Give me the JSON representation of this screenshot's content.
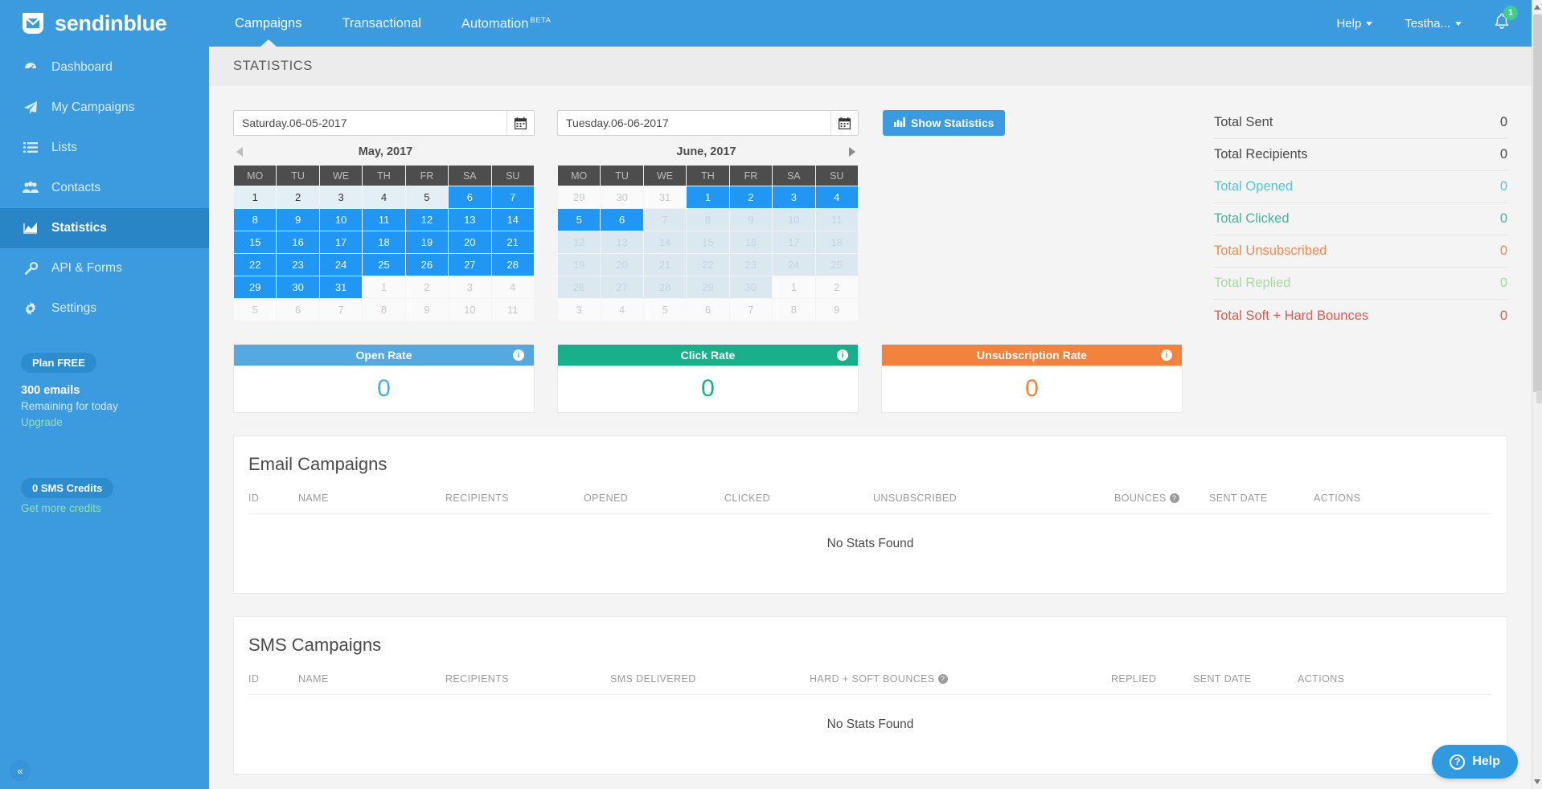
{
  "brand": {
    "name": "sendinblue",
    "logo_icon": "envelope-logo-icon"
  },
  "topnav": {
    "items": [
      {
        "label": "Campaigns",
        "active": true
      },
      {
        "label": "Transactional",
        "active": false
      },
      {
        "label": "Automation",
        "badge": "BETA",
        "active": false
      }
    ],
    "right": {
      "help_label": "Help",
      "account_label": "Testha...",
      "bell_icon": "bell-icon",
      "notification_count": "1"
    }
  },
  "sidebar": {
    "items": [
      {
        "label": "Dashboard",
        "icon": "dashboard-icon",
        "active": false
      },
      {
        "label": "My Campaigns",
        "icon": "paper-plane-icon",
        "active": false
      },
      {
        "label": "Lists",
        "icon": "list-icon",
        "active": false
      },
      {
        "label": "Contacts",
        "icon": "contacts-icon",
        "active": false
      },
      {
        "label": "Statistics",
        "icon": "chart-icon",
        "active": true
      },
      {
        "label": "API & Forms",
        "icon": "wrench-icon",
        "active": false
      },
      {
        "label": "Settings",
        "icon": "gear-icon",
        "active": false
      }
    ],
    "plan": {
      "badge": "Plan FREE",
      "emails": "300 emails",
      "remaining": "Remaining for today",
      "upgrade_link": "Upgrade"
    },
    "sms": {
      "badge": "0 SMS Credits",
      "link": "Get more credits"
    },
    "collapse_icon": "chevron-double-left-icon"
  },
  "page": {
    "title": "STATISTICS"
  },
  "date_range": {
    "start": {
      "value": "Saturday.06-05-2017",
      "calendar_icon": "calendar-icon",
      "month_label": "May, 2017",
      "weekdays": [
        "MO",
        "TU",
        "WE",
        "TH",
        "FR",
        "SA",
        "SU"
      ],
      "prev_arrow": "chevron-left-icon",
      "weeks": [
        [
          {
            "d": "1",
            "s": "pale"
          },
          {
            "d": "2",
            "s": "pale"
          },
          {
            "d": "3",
            "s": "pale"
          },
          {
            "d": "4",
            "s": "pale"
          },
          {
            "d": "5",
            "s": "pale"
          },
          {
            "d": "6",
            "s": "sel"
          },
          {
            "d": "7",
            "s": "sel"
          }
        ],
        [
          {
            "d": "8",
            "s": "sel"
          },
          {
            "d": "9",
            "s": "sel"
          },
          {
            "d": "10",
            "s": "sel"
          },
          {
            "d": "11",
            "s": "sel"
          },
          {
            "d": "12",
            "s": "sel"
          },
          {
            "d": "13",
            "s": "sel"
          },
          {
            "d": "14",
            "s": "sel"
          }
        ],
        [
          {
            "d": "15",
            "s": "sel"
          },
          {
            "d": "16",
            "s": "sel"
          },
          {
            "d": "17",
            "s": "sel"
          },
          {
            "d": "18",
            "s": "sel"
          },
          {
            "d": "19",
            "s": "sel"
          },
          {
            "d": "20",
            "s": "sel"
          },
          {
            "d": "21",
            "s": "sel"
          }
        ],
        [
          {
            "d": "22",
            "s": "sel"
          },
          {
            "d": "23",
            "s": "sel"
          },
          {
            "d": "24",
            "s": "sel"
          },
          {
            "d": "25",
            "s": "sel"
          },
          {
            "d": "26",
            "s": "sel"
          },
          {
            "d": "27",
            "s": "sel"
          },
          {
            "d": "28",
            "s": "sel"
          }
        ],
        [
          {
            "d": "29",
            "s": "sel"
          },
          {
            "d": "30",
            "s": "sel"
          },
          {
            "d": "31",
            "s": "sel"
          },
          {
            "d": "1",
            "s": "out"
          },
          {
            "d": "2",
            "s": "out"
          },
          {
            "d": "3",
            "s": "out"
          },
          {
            "d": "4",
            "s": "out"
          }
        ],
        [
          {
            "d": "5",
            "s": "out"
          },
          {
            "d": "6",
            "s": "out"
          },
          {
            "d": "7",
            "s": "out"
          },
          {
            "d": "8",
            "s": "out"
          },
          {
            "d": "9",
            "s": "out"
          },
          {
            "d": "10",
            "s": "out"
          },
          {
            "d": "11",
            "s": "out"
          }
        ]
      ]
    },
    "end": {
      "value": "Tuesday.06-06-2017",
      "calendar_icon": "calendar-icon",
      "month_label": "June, 2017",
      "weekdays": [
        "MO",
        "TU",
        "WE",
        "TH",
        "FR",
        "SA",
        "SU"
      ],
      "next_arrow": "chevron-right-icon",
      "weeks": [
        [
          {
            "d": "29",
            "s": "out"
          },
          {
            "d": "30",
            "s": "out"
          },
          {
            "d": "31",
            "s": "out"
          },
          {
            "d": "1",
            "s": "sel"
          },
          {
            "d": "2",
            "s": "sel"
          },
          {
            "d": "3",
            "s": "sel"
          },
          {
            "d": "4",
            "s": "sel"
          }
        ],
        [
          {
            "d": "5",
            "s": "sel"
          },
          {
            "d": "6",
            "s": "sel"
          },
          {
            "d": "7",
            "s": "rangedim"
          },
          {
            "d": "8",
            "s": "rangedim"
          },
          {
            "d": "9",
            "s": "rangedim"
          },
          {
            "d": "10",
            "s": "rangedim"
          },
          {
            "d": "11",
            "s": "rangedim"
          }
        ],
        [
          {
            "d": "12",
            "s": "rangedim"
          },
          {
            "d": "13",
            "s": "rangedim"
          },
          {
            "d": "14",
            "s": "rangedim"
          },
          {
            "d": "15",
            "s": "rangedim"
          },
          {
            "d": "16",
            "s": "rangedim"
          },
          {
            "d": "17",
            "s": "rangedim"
          },
          {
            "d": "18",
            "s": "rangedim"
          }
        ],
        [
          {
            "d": "19",
            "s": "rangedim"
          },
          {
            "d": "20",
            "s": "rangedim"
          },
          {
            "d": "21",
            "s": "rangedim"
          },
          {
            "d": "22",
            "s": "rangedim"
          },
          {
            "d": "23",
            "s": "rangedim"
          },
          {
            "d": "24",
            "s": "rangedim"
          },
          {
            "d": "25",
            "s": "rangedim"
          }
        ],
        [
          {
            "d": "26",
            "s": "rangedim"
          },
          {
            "d": "27",
            "s": "rangedim"
          },
          {
            "d": "28",
            "s": "rangedim"
          },
          {
            "d": "29",
            "s": "rangedim"
          },
          {
            "d": "30",
            "s": "rangedim"
          },
          {
            "d": "1",
            "s": "out"
          },
          {
            "d": "2",
            "s": "out"
          }
        ],
        [
          {
            "d": "3",
            "s": "out"
          },
          {
            "d": "4",
            "s": "out"
          },
          {
            "d": "5",
            "s": "out"
          },
          {
            "d": "6",
            "s": "out"
          },
          {
            "d": "7",
            "s": "out"
          },
          {
            "d": "8",
            "s": "out"
          },
          {
            "d": "9",
            "s": "out"
          }
        ]
      ]
    },
    "show_statistics_button": "Show Statistics",
    "show_statistics_icon": "bar-chart-icon"
  },
  "totals": [
    {
      "label": "Total Sent",
      "value": "0",
      "color": "#4a4a4a"
    },
    {
      "label": "Total Recipients",
      "value": "0",
      "color": "#4a4a4a"
    },
    {
      "label": "Total Opened",
      "value": "0",
      "color": "#58c3d8"
    },
    {
      "label": "Total Clicked",
      "value": "0",
      "color": "#45b39c"
    },
    {
      "label": "Total Unsubscribed",
      "value": "0",
      "color": "#f08a4b"
    },
    {
      "label": "Total Replied",
      "value": "0",
      "color": "#a5dba0"
    },
    {
      "label": "Total Soft + Hard Bounces",
      "value": "0",
      "color": "#e0584f"
    }
  ],
  "rate_cards": [
    {
      "title": "Open Rate",
      "value": "0",
      "color": "#54a9e0",
      "info_icon": "info-icon"
    },
    {
      "title": "Click Rate",
      "value": "0",
      "color": "#1aaf8b",
      "info_icon": "info-icon"
    },
    {
      "title": "Unsubscription Rate",
      "value": "0",
      "color": "#f2823c",
      "info_icon": "info-icon"
    }
  ],
  "email_campaigns": {
    "title": "Email Campaigns",
    "columns": [
      "ID",
      "NAME",
      "RECIPIENTS",
      "OPENED",
      "CLICKED",
      "UNSUBSCRIBED",
      "BOUNCES",
      "SENT DATE",
      "ACTIONS"
    ],
    "bounces_help_icon": "question-icon",
    "empty_message": "No Stats Found"
  },
  "sms_campaigns": {
    "title": "SMS Campaigns",
    "columns": [
      "ID",
      "NAME",
      "RECIPIENTS",
      "SMS DELIVERED",
      "HARD + SOFT BOUNCES",
      "REPLIED",
      "SENT DATE",
      "ACTIONS"
    ],
    "bounces_help_icon": "question-icon",
    "empty_message": "No Stats Found"
  },
  "help_widget": {
    "label": "Help",
    "icon": "question-circle-icon"
  }
}
